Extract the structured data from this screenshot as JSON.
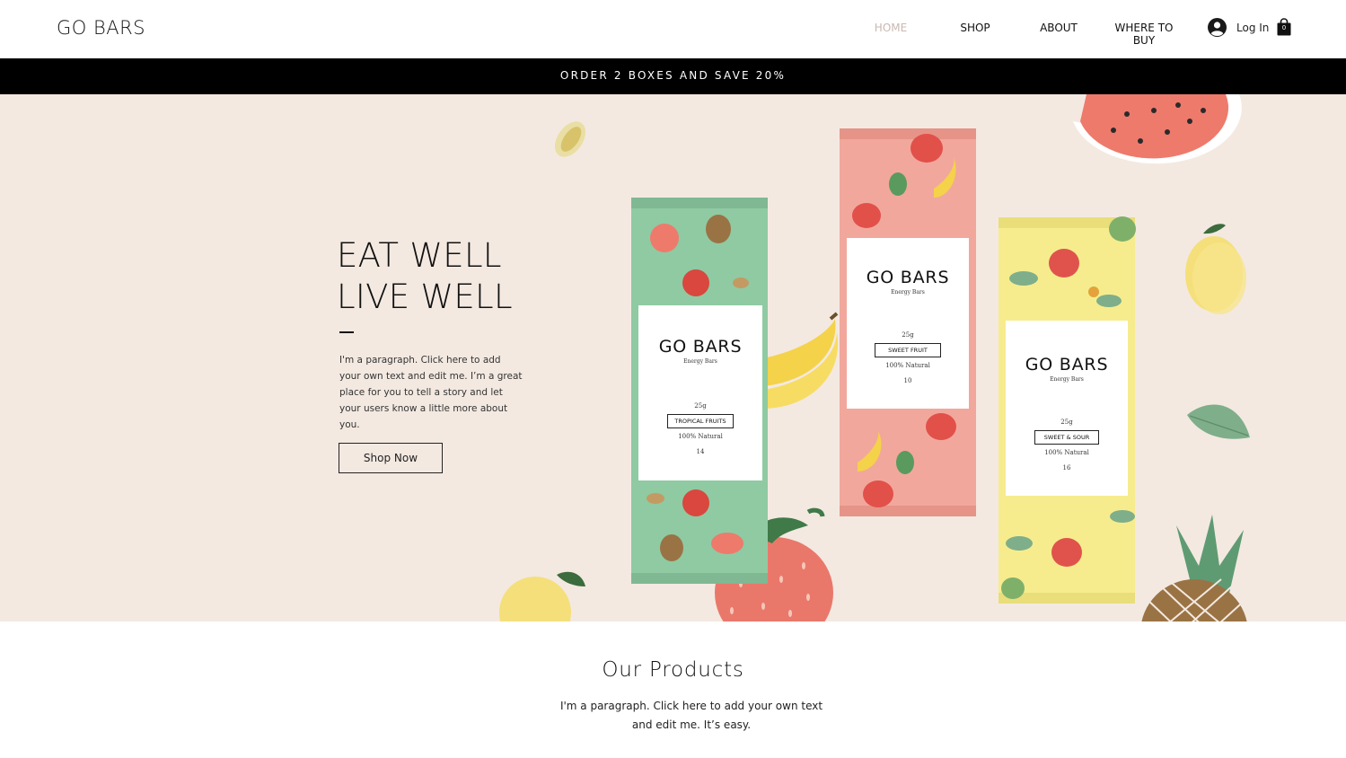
{
  "header": {
    "logo": "GO BARS",
    "nav": [
      {
        "label": "HOME",
        "active": true
      },
      {
        "label": "SHOP",
        "active": false
      },
      {
        "label": "ABOUT",
        "active": false
      },
      {
        "label": "WHERE TO BUY",
        "active": false
      }
    ],
    "login_label": "Log In",
    "login_icon": "user-avatar-icon",
    "cart_icon": "shopping-bag-icon",
    "cart_count": "0"
  },
  "announcement": "ORDER 2 BOXES AND SAVE 20%",
  "hero": {
    "title_line1": "EAT WELL",
    "title_line2": "LIVE WELL",
    "paragraph": "I'm a paragraph. Click here to add your own text and edit me. I’m a great place for you to tell a story and let your users know a little more about you.",
    "button_label": "Shop Now",
    "background_color": "#f3e9e1",
    "products": [
      {
        "brand": "GO BARS",
        "subtitle": "Energy Bars",
        "weight": "25g",
        "flavor": "TROPICAL FRUITS",
        "natural": "100% Natural",
        "number": "14",
        "color": "#8fcaa3"
      },
      {
        "brand": "GO BARS",
        "subtitle": "Energy Bars",
        "weight": "25g",
        "flavor": "SWEET FRUIT",
        "natural": "100% Natural",
        "number": "10",
        "color": "#f2a79c"
      },
      {
        "brand": "GO BARS",
        "subtitle": "Energy Bars",
        "weight": "25g",
        "flavor": "SWEET & SOUR",
        "natural": "100% Natural",
        "number": "16",
        "color": "#f6ec8d"
      }
    ]
  },
  "products_section": {
    "title": "Our Products",
    "paragraph": "I'm a paragraph. Click here to add your own text and edit me. It’s easy."
  }
}
